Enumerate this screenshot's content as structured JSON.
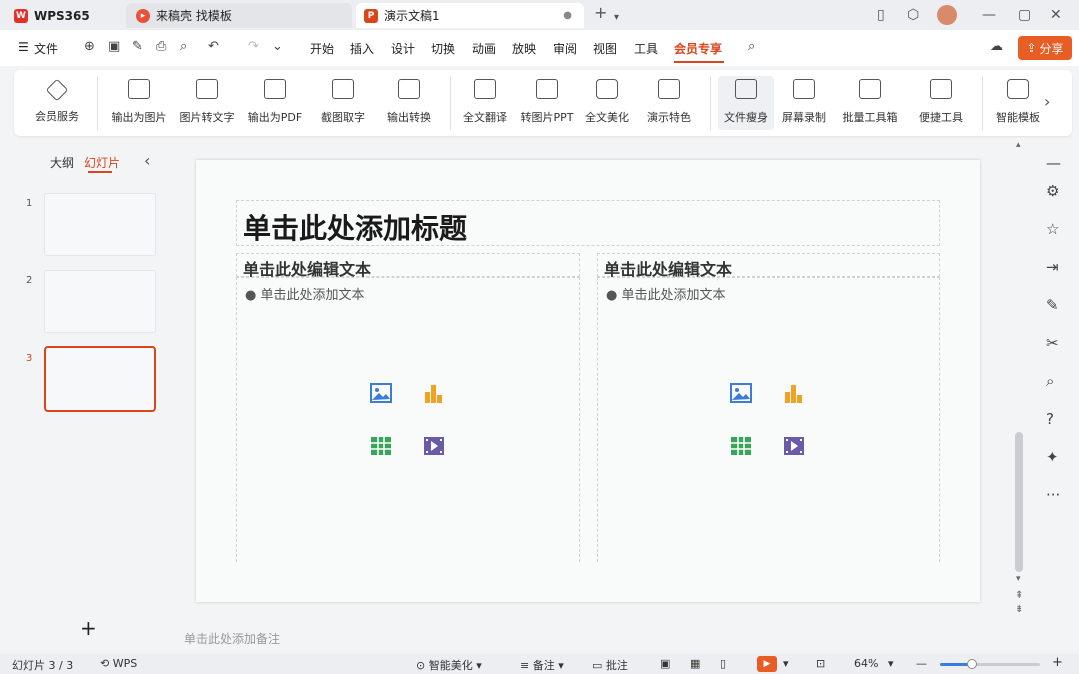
{
  "titlebar": {
    "app_tab": "WPS365",
    "template_tab": "来稿壳 找模板",
    "doc_tab": "演示文稿1",
    "new_tab": "+",
    "avatar_text": "头像"
  },
  "menubar": {
    "file": "文件",
    "items": [
      "开始",
      "插入",
      "设计",
      "切换",
      "动画",
      "放映",
      "审阅",
      "视图",
      "工具",
      "会员专享"
    ],
    "active": "会员专享",
    "share": "分享"
  },
  "ribbon": {
    "items": [
      "会员服务",
      "输出为图片",
      "图片转文字",
      "输出为PDF",
      "截图取字",
      "输出转换",
      "全文翻译",
      "转图片PPT",
      "全文美化",
      "演示特色",
      "文件瘦身",
      "屏幕录制",
      "批量工具箱",
      "便捷工具",
      "智能模板"
    ],
    "dropdowns": [
      "▾"
    ]
  },
  "leftpanel": {
    "tabs": [
      "大纲",
      "幻灯片"
    ],
    "active_tab": "幻灯片",
    "slide_numbers": [
      "1",
      "2",
      "3"
    ],
    "selected_slide": 3,
    "add_label": "+"
  },
  "slide": {
    "title_placeholder": "单击此处添加标题",
    "left_heading": "单击此处编辑文本",
    "left_bullet": "单击此处添加文本",
    "right_heading": "单击此处编辑文本",
    "right_bullet": "单击此处添加文本"
  },
  "notes": {
    "placeholder": "单击此处添加备注"
  },
  "statusbar": {
    "slide_count": "幻灯片 3 / 3",
    "wps_label": "WPS",
    "beautify": "智能美化",
    "notes_btn": "备注",
    "comments_btn": "批注",
    "zoom": "64%",
    "zoom_fraction": 0.64
  },
  "colors": {
    "accent": "#d9461c",
    "share": "#e85d24",
    "image_icon": "#3d7bd9",
    "chart_icon": "#f0a322",
    "table_icon": "#3aa55a",
    "video_icon": "#6a5aa8"
  }
}
